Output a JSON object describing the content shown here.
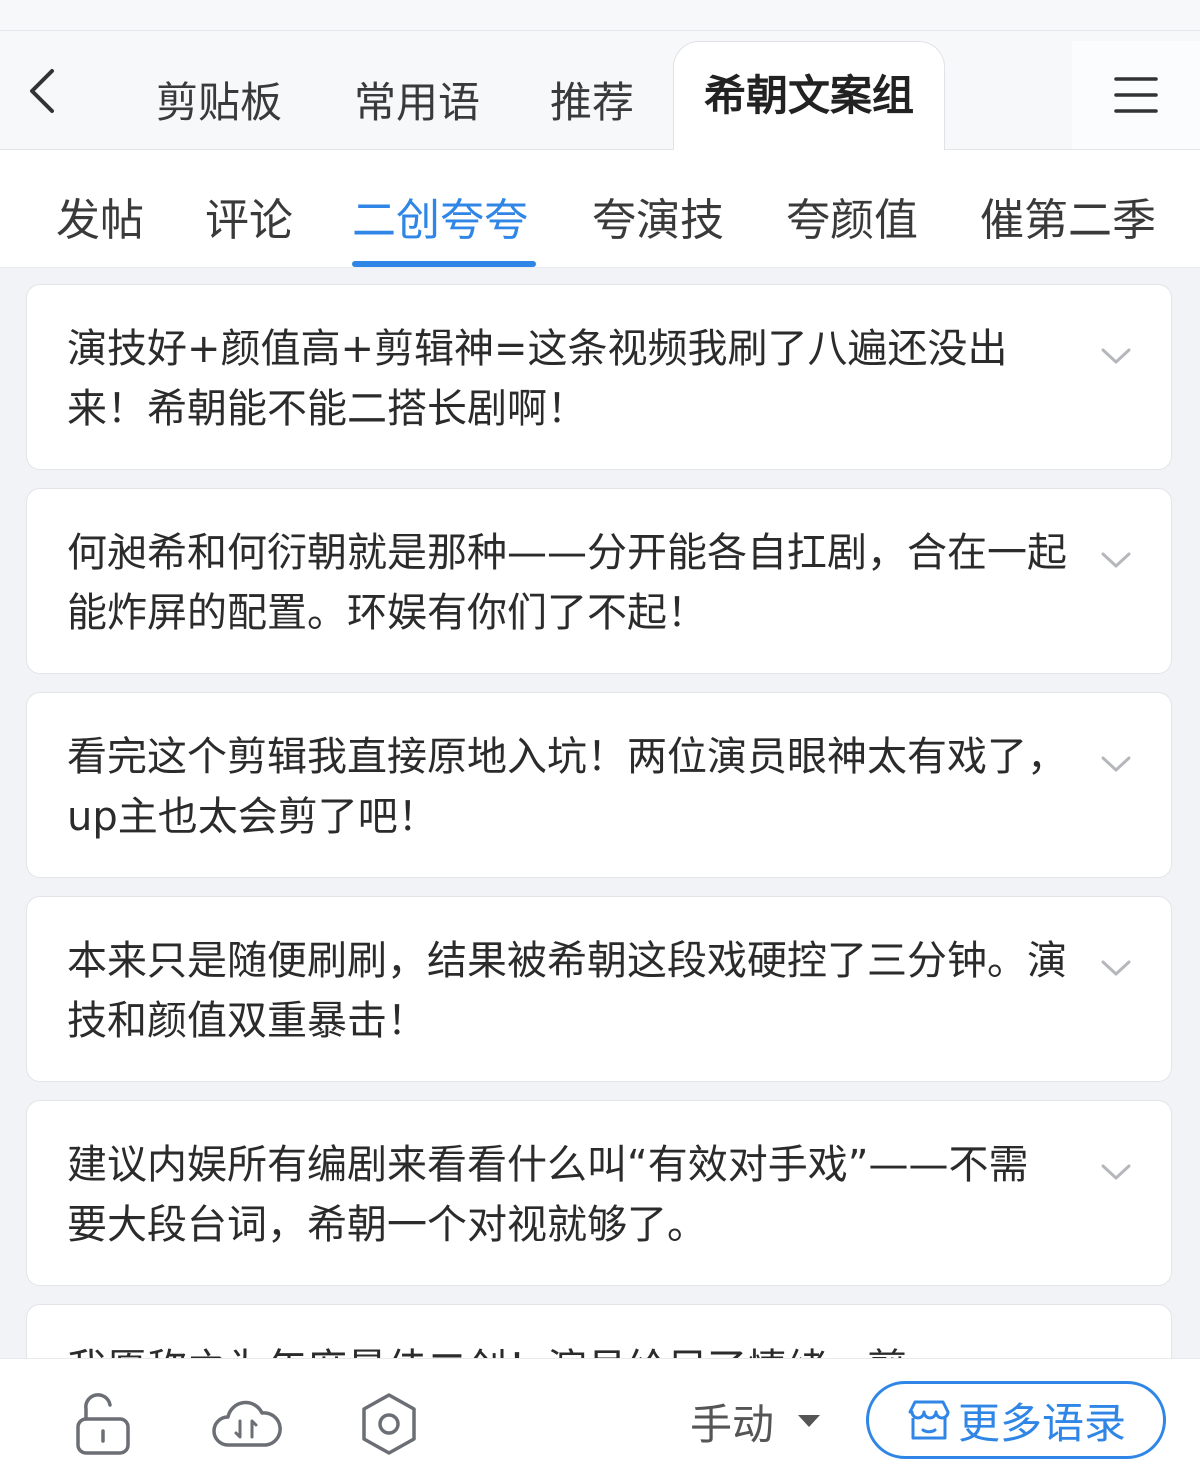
{
  "header": {
    "tabs": [
      {
        "label": "剪贴板"
      },
      {
        "label": "常用语"
      },
      {
        "label": "推荐"
      },
      {
        "label": "希朝文案组",
        "active": true
      }
    ]
  },
  "subtabs": [
    {
      "label": "发帖"
    },
    {
      "label": "评论"
    },
    {
      "label": "二创夸夸",
      "active": true
    },
    {
      "label": "夸演技"
    },
    {
      "label": "夸颜值"
    },
    {
      "label": "催第二季"
    }
  ],
  "phrases": [
    "演技好+颜值高+剪辑神=这条视频我刷了八遍还没出来！希朝能不能二搭长剧啊！",
    "何昶希和何衍朝就是那种——分开能各自扛剧，合在一起能炸屏的配置。环娱有你们了不起！",
    " 看完这个剪辑我直接原地入坑！两位演员眼神太有戏了，up主也太会剪了吧！",
    "本来只是随便刷刷，结果被希朝这段戏硬控了三分钟。演技和颜值双重暴击！",
    "建议内娱所有编剧来看看什么叫“有效对手戏”——不需要大段台词，希朝一个对视就够了。",
    "我愿称之为年度最佳二创！演员给足了情绪，剪"
  ],
  "bottom": {
    "mode_label": "手动",
    "more_label": "更多语录",
    "icons": [
      "lock-open-icon",
      "cloud-sync-icon",
      "hexagon-settings-icon",
      "store-icon"
    ]
  },
  "colors": {
    "accent": "#2f86e6",
    "background": "#f2f3f7",
    "card": "#ffffff"
  }
}
